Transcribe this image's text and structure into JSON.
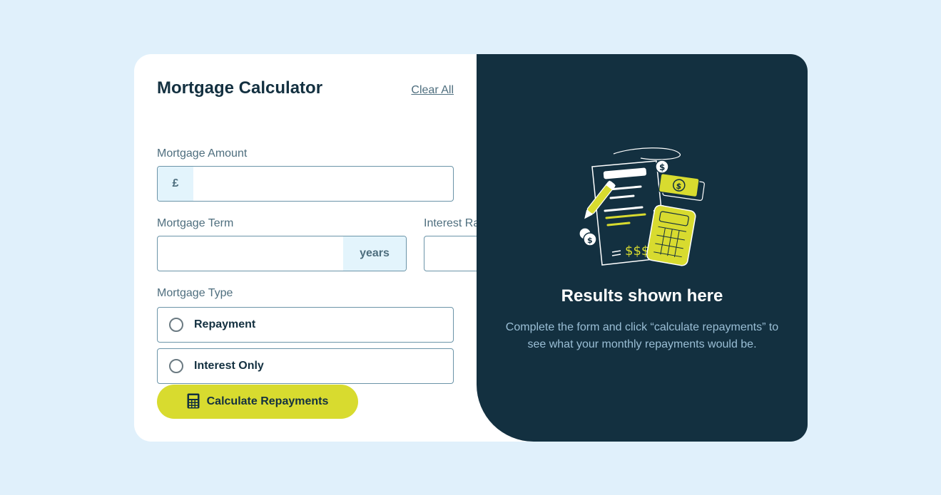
{
  "form": {
    "title": "Mortgage Calculator",
    "clear_label": "Clear All",
    "amount": {
      "label": "Mortgage Amount",
      "prefix": "£",
      "value": "",
      "placeholder": ""
    },
    "term": {
      "label": "Mortgage Term",
      "suffix": "years",
      "value": "",
      "placeholder": ""
    },
    "rate": {
      "label": "Interest Rate",
      "suffix": "%",
      "value": "",
      "placeholder": ""
    },
    "type": {
      "label": "Mortgage Type",
      "options": [
        {
          "label": "Repayment",
          "selected": false
        },
        {
          "label": "Interest Only",
          "selected": false
        }
      ]
    },
    "submit_label": "Calculate Repayments"
  },
  "results": {
    "title": "Results shown here",
    "description": "Complete the form and click “calculate repayments” to see what your monthly repayments would be."
  },
  "colors": {
    "background": "#e0f0fb",
    "card": "#ffffff",
    "primary_dark": "#133040",
    "accent_lime": "#d8db2f",
    "affix_bg": "#e3f4fc",
    "muted_text": "#4e6e7e",
    "results_text": "#9abed5"
  },
  "icons": {
    "calculator": "calculator-icon",
    "illustration": "empty-results-illustration"
  }
}
